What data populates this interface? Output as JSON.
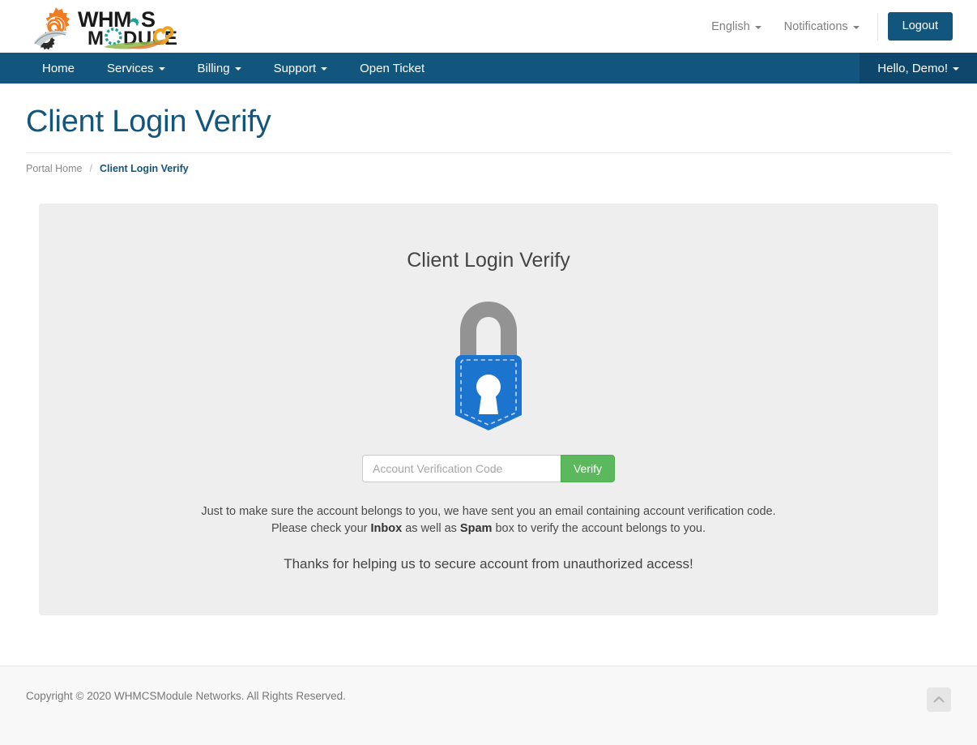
{
  "header": {
    "logo_alt": "WHMCSMODULE",
    "language": "English",
    "notifications": "Notifications",
    "logout": "Logout"
  },
  "nav": {
    "items": [
      {
        "label": "Home",
        "has_caret": false
      },
      {
        "label": "Services",
        "has_caret": true
      },
      {
        "label": "Billing",
        "has_caret": true
      },
      {
        "label": "Support",
        "has_caret": true
      },
      {
        "label": "Open Ticket",
        "has_caret": false
      }
    ],
    "user": "Hello, Demo!"
  },
  "page": {
    "title": "Client Login Verify"
  },
  "breadcrumb": {
    "home": "Portal Home",
    "separator": "/",
    "current": "Client Login Verify"
  },
  "panel": {
    "heading": "Client Login Verify",
    "lock_icon": "lock-badge-icon",
    "input_placeholder": "Account Verification Code",
    "input_value": "",
    "verify_button": "Verify",
    "desc_line1": "Just to make sure the account belongs to you, we have sent you an email containing account verification code.",
    "desc_line2_pre": "Please check your ",
    "desc_line2_bold1": "Inbox",
    "desc_line2_mid": " as well as ",
    "desc_line2_bold2": "Spam",
    "desc_line2_post": " box to verify the account belongs to you.",
    "thanks": "Thanks for helping us to secure account from unauthorized access!"
  },
  "footer": {
    "copyright": "Copyright © 2020 WHMCSModule Networks. All Rights Reserved.",
    "to_top_icon": "chevron-up-icon"
  },
  "colors": {
    "brand_navy": "#12557d",
    "nav_user_bg": "#0e476b",
    "panel_bg": "#eeeeee",
    "success_green": "#5cb85c",
    "lock_blue": "#1b75cf",
    "lock_gray": "#939393"
  }
}
